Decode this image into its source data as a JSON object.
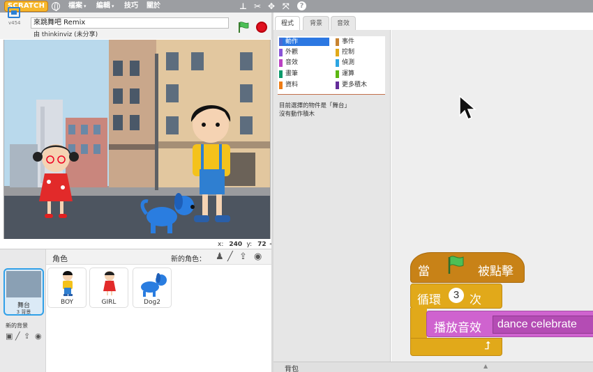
{
  "menubar": {
    "logo": "SCRATCH",
    "menus": [
      "檔案",
      "編輯",
      "技巧",
      "關於"
    ],
    "caret": "▾"
  },
  "stage_header": {
    "version": "v454",
    "project_title": "來跳舞吧 Remix",
    "author": "由 thinkinviz (未分享)"
  },
  "mouse": {
    "x_label": "x:",
    "x": "240",
    "y_label": "y:",
    "y": "72"
  },
  "sprites_panel": {
    "title": "角色",
    "new_sprite_label": "新的角色：",
    "stage_tile": {
      "name": "舞台",
      "sub": "3 背景"
    },
    "sprites": [
      {
        "name": "BOY"
      },
      {
        "name": "GIRL"
      },
      {
        "name": "Dog2"
      }
    ],
    "new_backdrop_label": "新的背景"
  },
  "tabs": [
    {
      "label": "程式",
      "active": true
    },
    {
      "label": "背景",
      "active": false
    },
    {
      "label": "音效",
      "active": false
    }
  ],
  "categories": [
    {
      "label": "動作",
      "color": "#4a6cd4",
      "selected": true
    },
    {
      "label": "事件",
      "color": "#c88330"
    },
    {
      "label": "外觀",
      "color": "#8a55d7"
    },
    {
      "label": "控制",
      "color": "#e1a91a"
    },
    {
      "label": "音效",
      "color": "#bb42c3"
    },
    {
      "label": "偵測",
      "color": "#2ca5e2"
    },
    {
      "label": "畫筆",
      "color": "#0e9a6c"
    },
    {
      "label": "運算",
      "color": "#5cb712"
    },
    {
      "label": "資料",
      "color": "#ee7d16"
    },
    {
      "label": "更多積木",
      "color": "#632d99"
    }
  ],
  "palette_message": {
    "line1": "目前選擇的物件是「舞台」",
    "line2": "沒有動作積木"
  },
  "script": {
    "hat_when": "當",
    "hat_clicked": "被點擊",
    "repeat_word": "循環",
    "repeat_count": "3",
    "repeat_times": "次",
    "sound_label": "播放音效",
    "sound_name": "dance celebrate"
  },
  "backpack": {
    "label": "背包"
  },
  "colors": {
    "events": "#c88217",
    "control": "#e1a91a",
    "sound": "#cf63cf",
    "selected_blue": "#2c78e2"
  }
}
